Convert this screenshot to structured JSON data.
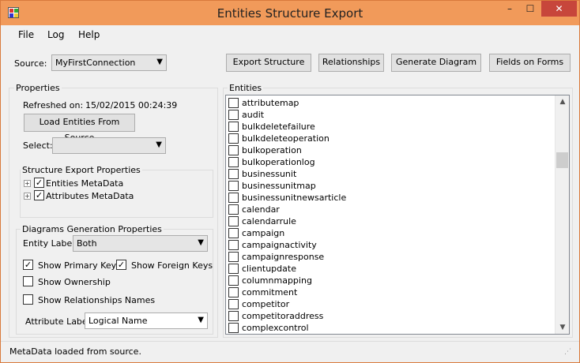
{
  "window": {
    "title": "Entities Structure Export",
    "minimize": "–",
    "maximize": "☐",
    "close": "✕"
  },
  "menu": [
    "File",
    "Log",
    "Help"
  ],
  "source": {
    "label": "Source:",
    "value": "MyFirstConnection"
  },
  "toolbar": {
    "export_structure": "Export Structure",
    "relationships": "Relationships",
    "generate_diagram": "Generate Diagram",
    "fields_on_forms": "Fields on Forms"
  },
  "properties": {
    "title": "Properties",
    "refreshed_label": "Refreshed on:",
    "refreshed_value": "15/02/2015 00:24:39",
    "load_button": "Load Entities From Source",
    "select_label": "Select:",
    "select_value": ""
  },
  "structure_export": {
    "title": "Structure Export Properties",
    "items": [
      {
        "label": "Entities MetaData",
        "checked": true
      },
      {
        "label": "Attributes MetaData",
        "checked": true
      }
    ]
  },
  "diagram_props": {
    "title": "Diagrams Generation Properties",
    "entity_label": "Entity Label:",
    "entity_value": "Both",
    "show_primary_keys": {
      "label": "Show Primary Keys",
      "checked": true
    },
    "show_foreign_keys": {
      "label": "Show Foreign Keys",
      "checked": true
    },
    "show_ownership": {
      "label": "Show Ownership",
      "checked": false
    },
    "show_relationship_names": {
      "label": "Show Relationships Names",
      "checked": false
    },
    "attribute_label": "Attribute Label:",
    "attribute_value": "Logical Name"
  },
  "entities": {
    "title": "Entities",
    "items": [
      "attributemap",
      "audit",
      "bulkdeletefailure",
      "bulkdeleteoperation",
      "bulkoperation",
      "bulkoperationlog",
      "businessunit",
      "businessunitmap",
      "businessunitnewsarticle",
      "calendar",
      "calendarrule",
      "campaign",
      "campaignactivity",
      "campaignresponse",
      "clientupdate",
      "columnmapping",
      "commitment",
      "competitor",
      "competitoraddress",
      "complexcontrol"
    ]
  },
  "status": {
    "text": "MetaData loaded from source."
  }
}
